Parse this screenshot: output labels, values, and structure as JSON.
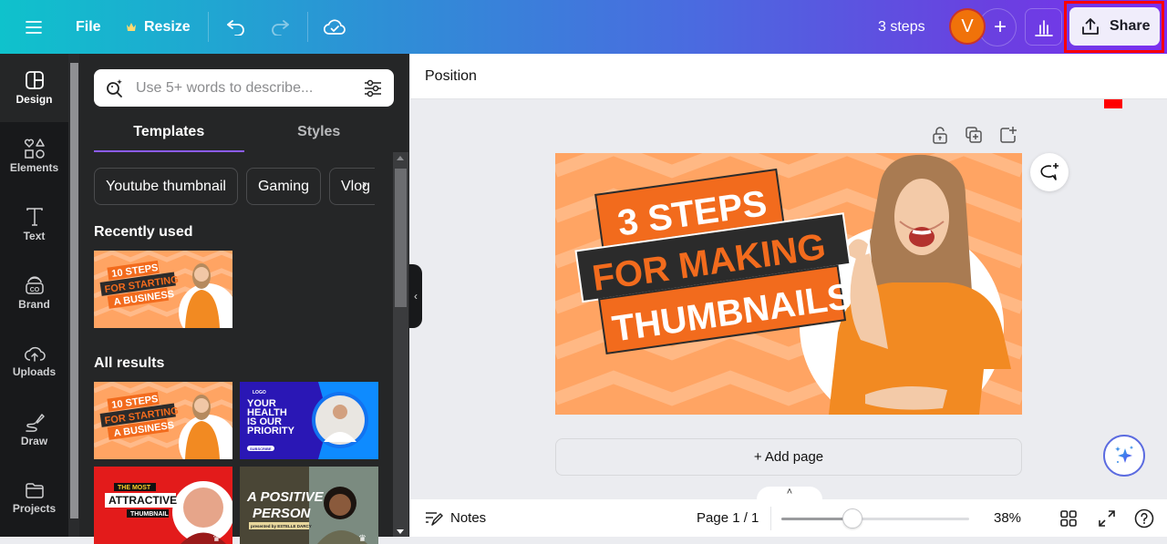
{
  "topbar": {
    "menu_icon": "hamburger-icon",
    "file_label": "File",
    "resize_label": "Resize",
    "resize_icon": "crown-icon",
    "undo_icon": "undo-icon",
    "redo_icon": "redo-icon",
    "cloud_icon": "cloud-saved-icon",
    "design_title": "3 steps",
    "avatar_initial": "V",
    "add_collaborator": "+",
    "insights_icon": "bar-chart-icon",
    "share_label": "Share",
    "share_icon": "upload-icon",
    "gradient_start": "#0fc2cc",
    "gradient_end": "#7b2ff0",
    "annotation_color": "#ff0000"
  },
  "rail": {
    "items": [
      {
        "label": "Design",
        "icon": "layout-icon",
        "active": true
      },
      {
        "label": "Elements",
        "icon": "shapes-icon"
      },
      {
        "label": "Text",
        "icon": "text-icon"
      },
      {
        "label": "Brand",
        "icon": "brand-icon"
      },
      {
        "label": "Uploads",
        "icon": "cloud-upload-icon"
      },
      {
        "label": "Draw",
        "icon": "draw-icon"
      },
      {
        "label": "Projects",
        "icon": "folder-icon"
      }
    ]
  },
  "panel": {
    "search_placeholder": "Use 5+ words to describe...",
    "tabs": [
      {
        "label": "Templates",
        "active": true
      },
      {
        "label": "Styles"
      }
    ],
    "chips": [
      "Youtube thumbnail",
      "Gaming",
      "Vlog"
    ],
    "recently_used_title": "Recently used",
    "all_results_title": "All results",
    "recent": [
      {
        "lines": [
          "10 STEPS",
          "FOR STARTING",
          "A BUSINESS"
        ]
      }
    ],
    "results": [
      {
        "lines": [
          "10 STEPS",
          "FOR STARTING",
          "A BUSINESS"
        ]
      },
      {
        "logo": "LOGO",
        "lines": [
          "YOUR",
          "HEALTH",
          "IS OUR",
          "PRIORITY"
        ],
        "cta": "SUBSCRIBE"
      },
      {
        "lines": [
          "THE MOST",
          "ATTRACTIVE",
          "THUMBNAIL"
        ]
      },
      {
        "lines": [
          "A POSITIVE",
          "PERSON",
          "presented by ESTELLE DARCY"
        ]
      }
    ]
  },
  "editor": {
    "position_label": "Position",
    "design": {
      "line1": "3 STEPS",
      "line2": "FOR MAKING",
      "line3": "THUMBNAILS",
      "accent": "#f26b1d",
      "bg": "#ffa463"
    },
    "add_page_label": "+ Add page"
  },
  "footer": {
    "notes_label": "Notes",
    "page_label": "Page 1 / 1",
    "zoom_label": "38%",
    "zoom_fraction": 0.38
  }
}
